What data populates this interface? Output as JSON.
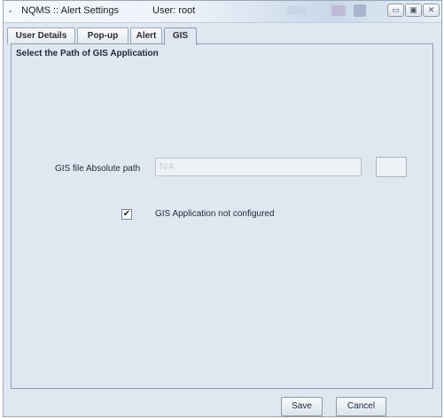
{
  "window": {
    "title": "NQMS :: Alert Settings",
    "user_label": "User: root",
    "controls": {
      "minimize": "▭",
      "maximize": "▣",
      "close": "✕"
    }
  },
  "tabs": [
    {
      "label": "User Details",
      "active": false
    },
    {
      "label": "Pop-up",
      "active": false
    },
    {
      "label": "Alert",
      "active": false
    },
    {
      "label": "GIS",
      "active": true
    }
  ],
  "gis": {
    "section_title": "Select the Path of GIS Application",
    "path_label": "GIS file Absolute path",
    "path_value": "N/A",
    "checkbox_checked": true,
    "checkbox_mark": "✔",
    "checkbox_label": "GIS Application not configured"
  },
  "footer": {
    "save_label": "Save",
    "cancel_label": "Cancel"
  },
  "icons": {
    "app_icon": "•",
    "app_icon_name": "app-icon",
    "checkmark": "check-icon"
  }
}
